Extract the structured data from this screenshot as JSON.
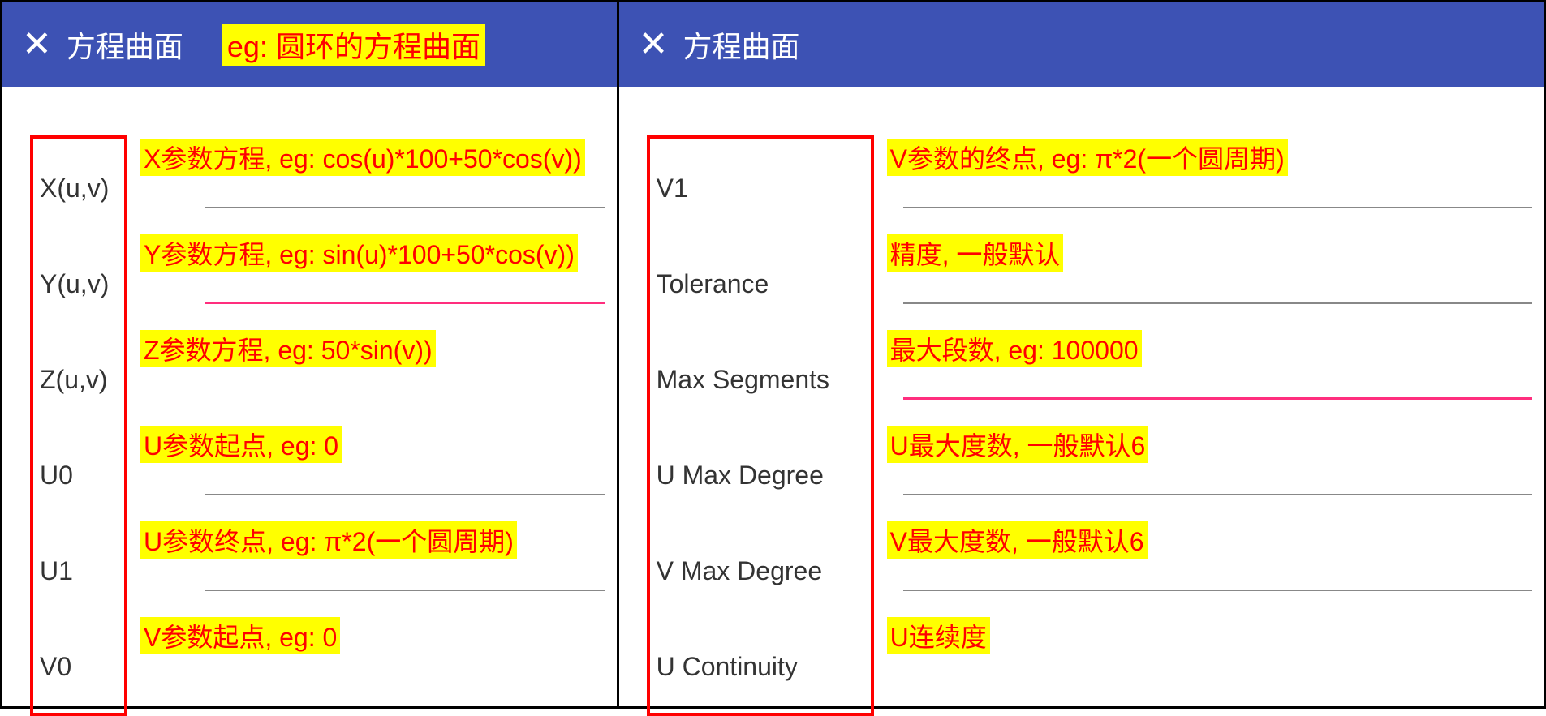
{
  "left": {
    "title": "方程曲面",
    "title_annotation": "eg: 圆环的方程曲面",
    "fields": [
      {
        "label": "X(u,v)",
        "annotation": "X参数方程, eg: cos(u)*100+50*cos(v))",
        "underline": "gray"
      },
      {
        "label": "Y(u,v)",
        "annotation": "Y参数方程, eg: sin(u)*100+50*cos(v))",
        "underline": "pink"
      },
      {
        "label": "Z(u,v)",
        "annotation": "Z参数方程, eg: 50*sin(v))",
        "underline": "none"
      },
      {
        "label": "U0",
        "annotation": "U参数起点, eg: 0",
        "underline": "gray"
      },
      {
        "label": "U1",
        "annotation": "U参数终点, eg: π*2(一个圆周期)",
        "underline": "gray"
      },
      {
        "label": "V0",
        "annotation": "V参数起点, eg: 0",
        "underline": "none"
      }
    ]
  },
  "right": {
    "title": "方程曲面",
    "fields": [
      {
        "label": "V1",
        "annotation": "V参数的终点, eg: π*2(一个圆周期)",
        "underline": "gray"
      },
      {
        "label": "Tolerance",
        "annotation": "精度, 一般默认",
        "underline": "gray"
      },
      {
        "label": "Max Segments",
        "annotation": "最大段数, eg: 100000",
        "underline": "pink"
      },
      {
        "label": "U Max Degree",
        "annotation": "U最大度数, 一般默认6",
        "underline": "gray"
      },
      {
        "label": "V Max Degree",
        "annotation": "V最大度数, 一般默认6",
        "underline": "gray"
      },
      {
        "label": "U Continuity",
        "annotation": "U连续度",
        "underline": "none"
      }
    ]
  }
}
